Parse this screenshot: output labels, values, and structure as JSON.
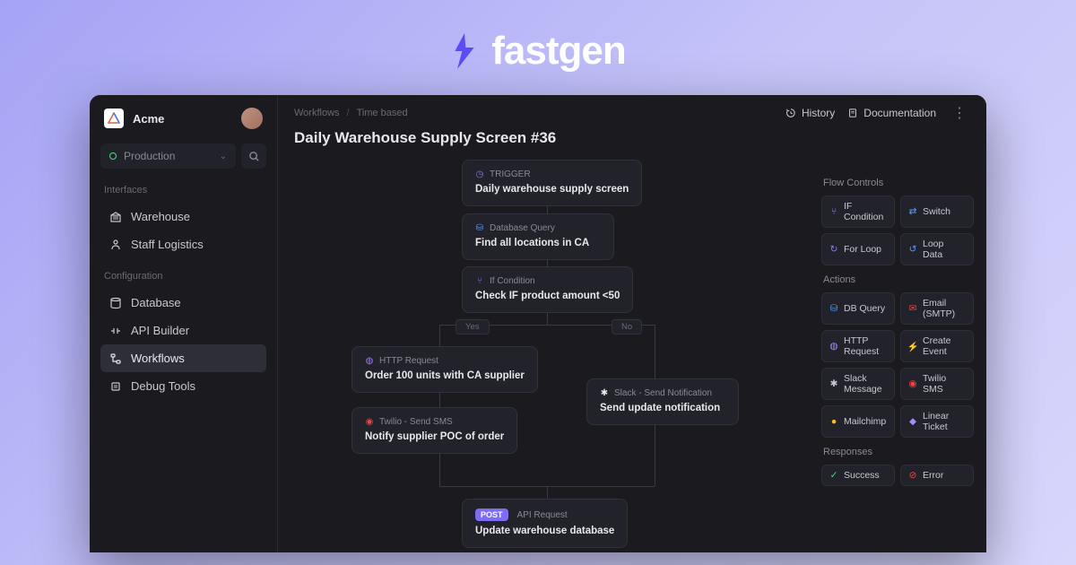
{
  "brand": {
    "name": "fastgen"
  },
  "org": {
    "name": "Acme"
  },
  "env": {
    "label": "Production"
  },
  "sidebar": {
    "section1": "Interfaces",
    "section2": "Configuration",
    "items": [
      {
        "label": "Warehouse"
      },
      {
        "label": "Staff Logistics"
      },
      {
        "label": "Database"
      },
      {
        "label": "API Builder"
      },
      {
        "label": "Workflows"
      },
      {
        "label": "Debug Tools"
      }
    ]
  },
  "breadcrumb": {
    "a": "Workflows",
    "b": "Time based"
  },
  "topbar": {
    "history": "History",
    "docs": "Documentation"
  },
  "page": {
    "title": "Daily Warehouse Supply Screen #36"
  },
  "nodes": {
    "trigger": {
      "type": "TRIGGER",
      "title": "Daily warehouse supply screen"
    },
    "dbquery": {
      "type": "Database Query",
      "title": "Find all locations in CA"
    },
    "ifcond": {
      "type": "If Condition",
      "title": "Check IF product amount <50"
    },
    "http": {
      "type": "HTTP Request",
      "title": "Order 100 units with CA supplier"
    },
    "twilio": {
      "type": "Twilio - Send SMS",
      "title": "Notify supplier POC of order"
    },
    "slack": {
      "type": "Slack - Send Notification",
      "title": "Send update notification"
    },
    "api": {
      "badge": "POST",
      "type": "API Request",
      "title": "Update warehouse database"
    }
  },
  "labels": {
    "yes": "Yes",
    "no": "No"
  },
  "panel": {
    "flowControls": "Flow Controls",
    "actions": "Actions",
    "responses": "Responses",
    "chips": {
      "ifcond": "IF Condition",
      "switch": "Switch",
      "forloop": "For Loop",
      "loopdata": "Loop Data",
      "dbquery": "DB Query",
      "email": "Email (SMTP)",
      "http": "HTTP Request",
      "event": "Create Event",
      "slack": "Slack Message",
      "twilio": "Twilio SMS",
      "mailchimp": "Mailchimp",
      "linear": "Linear Ticket",
      "success": "Success",
      "error": "Error"
    }
  }
}
